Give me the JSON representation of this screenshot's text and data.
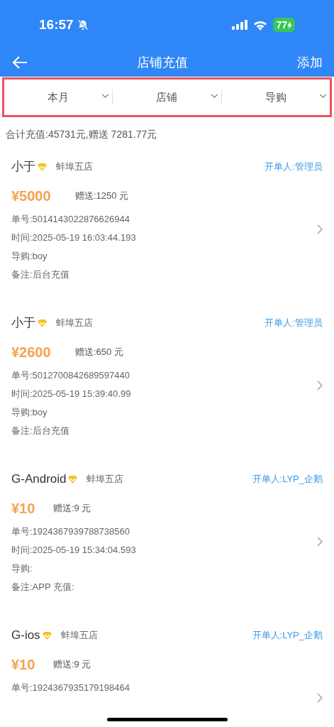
{
  "status_bar": {
    "time": "16:57",
    "battery": "77"
  },
  "nav": {
    "title": "店铺充值",
    "action": "添加"
  },
  "filters": [
    {
      "label": "本月"
    },
    {
      "label": "店铺"
    },
    {
      "label": "导购"
    }
  ],
  "summary": "合计充值:45731元,赠送 7281.77元",
  "records": [
    {
      "name": "小于",
      "store": "蚌埠五店",
      "operator": "开单人:管理员",
      "amount": "¥5000",
      "bonus": "赠送:1250 元",
      "details": [
        "单号:5014143022876626944",
        "时间:2025-05-19 16:03:44.193",
        "导购:boy",
        "备注:后台充值"
      ]
    },
    {
      "name": "小于",
      "store": "蚌埠五店",
      "operator": "开单人:管理员",
      "amount": "¥2600",
      "bonus": "赠送:650 元",
      "details": [
        "单号:5012700842689597440",
        "时间:2025-05-19 15:39:40.99",
        "导购:boy",
        "备注:后台充值"
      ]
    },
    {
      "name": "G-Android",
      "store": "蚌埠五店",
      "operator": "开单人:LYP_企鹅",
      "amount": "¥10",
      "bonus": "赠送:9 元",
      "details": [
        "单号:1924367939788738560",
        "时间:2025-05-19 15:34:04.593",
        "导购:",
        "备注:APP 充值:"
      ]
    },
    {
      "name": "G-ios",
      "store": "蚌埠五店",
      "operator": "开单人:LYP_企鹅",
      "amount": "¥10",
      "bonus": "赠送:9 元",
      "details": [
        "单号:1924367935179198464"
      ]
    }
  ]
}
